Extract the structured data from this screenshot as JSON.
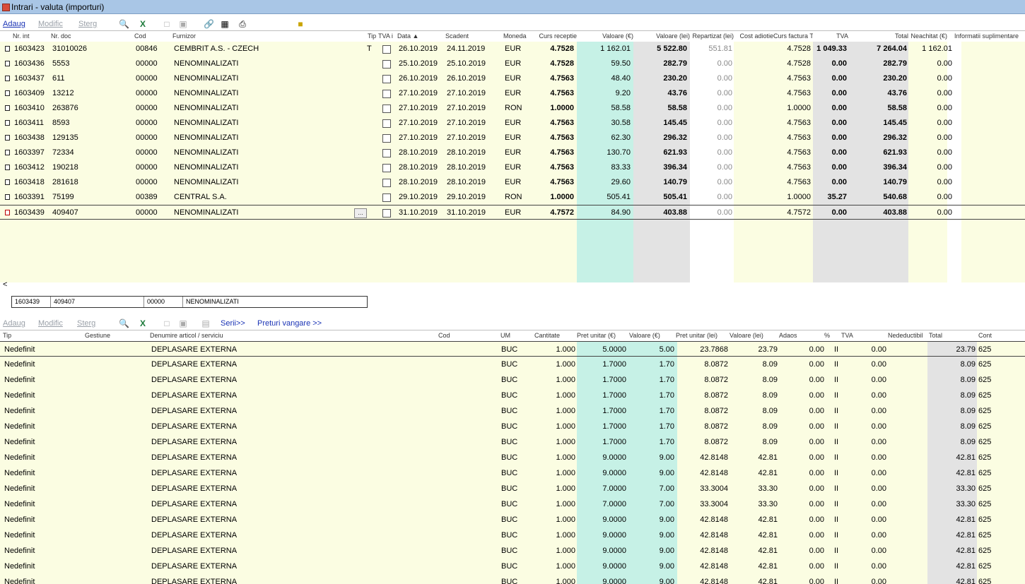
{
  "window": {
    "title": "Intrari - valuta (importuri)"
  },
  "toolbar_top": {
    "add": "Adaug",
    "modify": "Modific",
    "delete": "Sterg"
  },
  "top_grid": {
    "columns": [
      "Nr. int",
      "Nr. doc",
      "Cod",
      "Furnizor",
      "Tip",
      "TVA i",
      "Data ▲",
      "Scadent",
      "Moneda",
      "Curs receptie",
      "Valoare (€)",
      "Valoare (lei)",
      "Repartizat (lei)",
      "Cost adiotie",
      "Curs factura TVA",
      "TVA",
      "Total",
      "Neachitat (€)",
      "Informatii suplimentare"
    ],
    "rows": [
      {
        "nr_int": "1603423",
        "nr_doc": "31010026",
        "cod": "00846",
        "furnizor": "CEMBRIT A.S. - CZECH",
        "tip": "T",
        "data": "26.10.2019",
        "scadent": "24.11.2019",
        "moneda": "EUR",
        "curs": "4.7528",
        "val_eur": "1 162.01",
        "val_lei": "5 522.80",
        "repartizat": "551.81",
        "curs_tva": "4.7528",
        "tva": "1 049.33",
        "total": "7 264.04",
        "neachitat": "1 162.01"
      },
      {
        "nr_int": "1603436",
        "nr_doc": "5553",
        "cod": "00000",
        "furnizor": "NENOMINALIZATI",
        "tip": "",
        "data": "25.10.2019",
        "scadent": "25.10.2019",
        "moneda": "EUR",
        "curs": "4.7528",
        "val_eur": "59.50",
        "val_lei": "282.79",
        "repartizat": "0.00",
        "curs_tva": "4.7528",
        "tva": "0.00",
        "total": "282.79",
        "neachitat": "0.00"
      },
      {
        "nr_int": "1603437",
        "nr_doc": "611",
        "cod": "00000",
        "furnizor": "NENOMINALIZATI",
        "tip": "",
        "data": "26.10.2019",
        "scadent": "26.10.2019",
        "moneda": "EUR",
        "curs": "4.7563",
        "val_eur": "48.40",
        "val_lei": "230.20",
        "repartizat": "0.00",
        "curs_tva": "4.7563",
        "tva": "0.00",
        "total": "230.20",
        "neachitat": "0.00"
      },
      {
        "nr_int": "1603409",
        "nr_doc": "13212",
        "cod": "00000",
        "furnizor": "NENOMINALIZATI",
        "tip": "",
        "data": "27.10.2019",
        "scadent": "27.10.2019",
        "moneda": "EUR",
        "curs": "4.7563",
        "val_eur": "9.20",
        "val_lei": "43.76",
        "repartizat": "0.00",
        "curs_tva": "4.7563",
        "tva": "0.00",
        "total": "43.76",
        "neachitat": "0.00"
      },
      {
        "nr_int": "1603410",
        "nr_doc": "263876",
        "cod": "00000",
        "furnizor": "NENOMINALIZATI",
        "tip": "",
        "data": "27.10.2019",
        "scadent": "27.10.2019",
        "moneda": "RON",
        "curs": "1.0000",
        "val_eur": "58.58",
        "val_lei": "58.58",
        "repartizat": "0.00",
        "curs_tva": "1.0000",
        "tva": "0.00",
        "total": "58.58",
        "neachitat": "0.00"
      },
      {
        "nr_int": "1603411",
        "nr_doc": "8593",
        "cod": "00000",
        "furnizor": "NENOMINALIZATI",
        "tip": "",
        "data": "27.10.2019",
        "scadent": "27.10.2019",
        "moneda": "EUR",
        "curs": "4.7563",
        "val_eur": "30.58",
        "val_lei": "145.45",
        "repartizat": "0.00",
        "curs_tva": "4.7563",
        "tva": "0.00",
        "total": "145.45",
        "neachitat": "0.00"
      },
      {
        "nr_int": "1603438",
        "nr_doc": "129135",
        "cod": "00000",
        "furnizor": "NENOMINALIZATI",
        "tip": "",
        "data": "27.10.2019",
        "scadent": "27.10.2019",
        "moneda": "EUR",
        "curs": "4.7563",
        "val_eur": "62.30",
        "val_lei": "296.32",
        "repartizat": "0.00",
        "curs_tva": "4.7563",
        "tva": "0.00",
        "total": "296.32",
        "neachitat": "0.00"
      },
      {
        "nr_int": "1603397",
        "nr_doc": "72334",
        "cod": "00000",
        "furnizor": "NENOMINALIZATI",
        "tip": "",
        "data": "28.10.2019",
        "scadent": "28.10.2019",
        "moneda": "EUR",
        "curs": "4.7563",
        "val_eur": "130.70",
        "val_lei": "621.93",
        "repartizat": "0.00",
        "curs_tva": "4.7563",
        "tva": "0.00",
        "total": "621.93",
        "neachitat": "0.00"
      },
      {
        "nr_int": "1603412",
        "nr_doc": "190218",
        "cod": "00000",
        "furnizor": "NENOMINALIZATI",
        "tip": "",
        "data": "28.10.2019",
        "scadent": "28.10.2019",
        "moneda": "EUR",
        "curs": "4.7563",
        "val_eur": "83.33",
        "val_lei": "396.34",
        "repartizat": "0.00",
        "curs_tva": "4.7563",
        "tva": "0.00",
        "total": "396.34",
        "neachitat": "0.00"
      },
      {
        "nr_int": "1603418",
        "nr_doc": "281618",
        "cod": "00000",
        "furnizor": "NENOMINALIZATI",
        "tip": "",
        "data": "28.10.2019",
        "scadent": "28.10.2019",
        "moneda": "EUR",
        "curs": "4.7563",
        "val_eur": "29.60",
        "val_lei": "140.79",
        "repartizat": "0.00",
        "curs_tva": "4.7563",
        "tva": "0.00",
        "total": "140.79",
        "neachitat": "0.00"
      },
      {
        "nr_int": "1603391",
        "nr_doc": "75199",
        "cod": "00389",
        "furnizor": "CENTRAL S.A.",
        "tip": "",
        "data": "29.10.2019",
        "scadent": "29.10.2019",
        "moneda": "RON",
        "curs": "1.0000",
        "val_eur": "505.41",
        "val_lei": "505.41",
        "repartizat": "0.00",
        "curs_tva": "1.0000",
        "tva": "35.27",
        "total": "540.68",
        "neachitat": "0.00"
      },
      {
        "nr_int": "1603439",
        "nr_doc": "409407",
        "cod": "00000",
        "furnizor": "NENOMINALIZATI",
        "tip": "",
        "data": "31.10.2019",
        "scadent": "31.10.2019",
        "moneda": "EUR",
        "curs": "4.7572",
        "val_eur": "84.90",
        "val_lei": "403.88",
        "repartizat": "0.00",
        "curs_tva": "4.7572",
        "tva": "0.00",
        "total": "403.88",
        "neachitat": "0.00"
      }
    ]
  },
  "selected_summary": [
    "1603439",
    "409407",
    "00000",
    "NENOMINALIZATI"
  ],
  "toolbar_bottom": {
    "add": "Adaug",
    "modify": "Modific",
    "delete": "Sterg",
    "serii": "Serii>>",
    "preturi": "Preturi vangare >>"
  },
  "bottom_grid": {
    "columns": [
      "Tip",
      "Gestiune",
      "Denumire articol / serviciu",
      "Cod",
      "UM",
      "Cantitate",
      "Pret unitar (€)",
      "Valoare (€)",
      "Pret unitar (lei)",
      "Valoare (lei)",
      "Adaos",
      "%",
      "TVA",
      "Nedeductibil",
      "Total",
      "Cont"
    ],
    "rows": [
      {
        "tip": "Nedefinit",
        "den": "DEPLASARE EXTERNA",
        "um": "BUC",
        "cant": "1.000",
        "pu_eur": "5.0000",
        "val_eur": "5.00",
        "pu_lei": "23.7868",
        "val_lei": "23.79",
        "adaos": "0.00",
        "pct": "II",
        "tva": "0.00",
        "total": "23.79",
        "cont": "625"
      },
      {
        "tip": "Nedefinit",
        "den": "DEPLASARE EXTERNA",
        "um": "BUC",
        "cant": "1.000",
        "pu_eur": "1.7000",
        "val_eur": "1.70",
        "pu_lei": "8.0872",
        "val_lei": "8.09",
        "adaos": "0.00",
        "pct": "II",
        "tva": "0.00",
        "total": "8.09",
        "cont": "625"
      },
      {
        "tip": "Nedefinit",
        "den": "DEPLASARE EXTERNA",
        "um": "BUC",
        "cant": "1.000",
        "pu_eur": "1.7000",
        "val_eur": "1.70",
        "pu_lei": "8.0872",
        "val_lei": "8.09",
        "adaos": "0.00",
        "pct": "II",
        "tva": "0.00",
        "total": "8.09",
        "cont": "625"
      },
      {
        "tip": "Nedefinit",
        "den": "DEPLASARE EXTERNA",
        "um": "BUC",
        "cant": "1.000",
        "pu_eur": "1.7000",
        "val_eur": "1.70",
        "pu_lei": "8.0872",
        "val_lei": "8.09",
        "adaos": "0.00",
        "pct": "II",
        "tva": "0.00",
        "total": "8.09",
        "cont": "625"
      },
      {
        "tip": "Nedefinit",
        "den": "DEPLASARE EXTERNA",
        "um": "BUC",
        "cant": "1.000",
        "pu_eur": "1.7000",
        "val_eur": "1.70",
        "pu_lei": "8.0872",
        "val_lei": "8.09",
        "adaos": "0.00",
        "pct": "II",
        "tva": "0.00",
        "total": "8.09",
        "cont": "625"
      },
      {
        "tip": "Nedefinit",
        "den": "DEPLASARE EXTERNA",
        "um": "BUC",
        "cant": "1.000",
        "pu_eur": "1.7000",
        "val_eur": "1.70",
        "pu_lei": "8.0872",
        "val_lei": "8.09",
        "adaos": "0.00",
        "pct": "II",
        "tva": "0.00",
        "total": "8.09",
        "cont": "625"
      },
      {
        "tip": "Nedefinit",
        "den": "DEPLASARE EXTERNA",
        "um": "BUC",
        "cant": "1.000",
        "pu_eur": "1.7000",
        "val_eur": "1.70",
        "pu_lei": "8.0872",
        "val_lei": "8.09",
        "adaos": "0.00",
        "pct": "II",
        "tva": "0.00",
        "total": "8.09",
        "cont": "625"
      },
      {
        "tip": "Nedefinit",
        "den": "DEPLASARE EXTERNA",
        "um": "BUC",
        "cant": "1.000",
        "pu_eur": "9.0000",
        "val_eur": "9.00",
        "pu_lei": "42.8148",
        "val_lei": "42.81",
        "adaos": "0.00",
        "pct": "II",
        "tva": "0.00",
        "total": "42.81",
        "cont": "625"
      },
      {
        "tip": "Nedefinit",
        "den": "DEPLASARE EXTERNA",
        "um": "BUC",
        "cant": "1.000",
        "pu_eur": "9.0000",
        "val_eur": "9.00",
        "pu_lei": "42.8148",
        "val_lei": "42.81",
        "adaos": "0.00",
        "pct": "II",
        "tva": "0.00",
        "total": "42.81",
        "cont": "625"
      },
      {
        "tip": "Nedefinit",
        "den": "DEPLASARE EXTERNA",
        "um": "BUC",
        "cant": "1.000",
        "pu_eur": "7.0000",
        "val_eur": "7.00",
        "pu_lei": "33.3004",
        "val_lei": "33.30",
        "adaos": "0.00",
        "pct": "II",
        "tva": "0.00",
        "total": "33.30",
        "cont": "625"
      },
      {
        "tip": "Nedefinit",
        "den": "DEPLASARE EXTERNA",
        "um": "BUC",
        "cant": "1.000",
        "pu_eur": "7.0000",
        "val_eur": "7.00",
        "pu_lei": "33.3004",
        "val_lei": "33.30",
        "adaos": "0.00",
        "pct": "II",
        "tva": "0.00",
        "total": "33.30",
        "cont": "625"
      },
      {
        "tip": "Nedefinit",
        "den": "DEPLASARE EXTERNA",
        "um": "BUC",
        "cant": "1.000",
        "pu_eur": "9.0000",
        "val_eur": "9.00",
        "pu_lei": "42.8148",
        "val_lei": "42.81",
        "adaos": "0.00",
        "pct": "II",
        "tva": "0.00",
        "total": "42.81",
        "cont": "625"
      },
      {
        "tip": "Nedefinit",
        "den": "DEPLASARE EXTERNA",
        "um": "BUC",
        "cant": "1.000",
        "pu_eur": "9.0000",
        "val_eur": "9.00",
        "pu_lei": "42.8148",
        "val_lei": "42.81",
        "adaos": "0.00",
        "pct": "II",
        "tva": "0.00",
        "total": "42.81",
        "cont": "625"
      },
      {
        "tip": "Nedefinit",
        "den": "DEPLASARE EXTERNA",
        "um": "BUC",
        "cant": "1.000",
        "pu_eur": "9.0000",
        "val_eur": "9.00",
        "pu_lei": "42.8148",
        "val_lei": "42.81",
        "adaos": "0.00",
        "pct": "II",
        "tva": "0.00",
        "total": "42.81",
        "cont": "625"
      },
      {
        "tip": "Nedefinit",
        "den": "DEPLASARE EXTERNA",
        "um": "BUC",
        "cant": "1.000",
        "pu_eur": "9.0000",
        "val_eur": "9.00",
        "pu_lei": "42.8148",
        "val_lei": "42.81",
        "adaos": "0.00",
        "pct": "II",
        "tva": "0.00",
        "total": "42.81",
        "cont": "625"
      },
      {
        "tip": "Nedefinit",
        "den": "DEPLASARE EXTERNA",
        "um": "BUC",
        "cant": "1.000",
        "pu_eur": "9.0000",
        "val_eur": "9.00",
        "pu_lei": "42.8148",
        "val_lei": "42.81",
        "adaos": "0.00",
        "pct": "II",
        "tva": "0.00",
        "total": "42.81",
        "cont": "625"
      }
    ]
  },
  "colors": {
    "title_bar": "#a9c6e6",
    "row_bg": "#fbfde2",
    "eur_col": "#c6f1e6",
    "lei_col": "#e3e3e3",
    "link": "#1a33b5"
  }
}
